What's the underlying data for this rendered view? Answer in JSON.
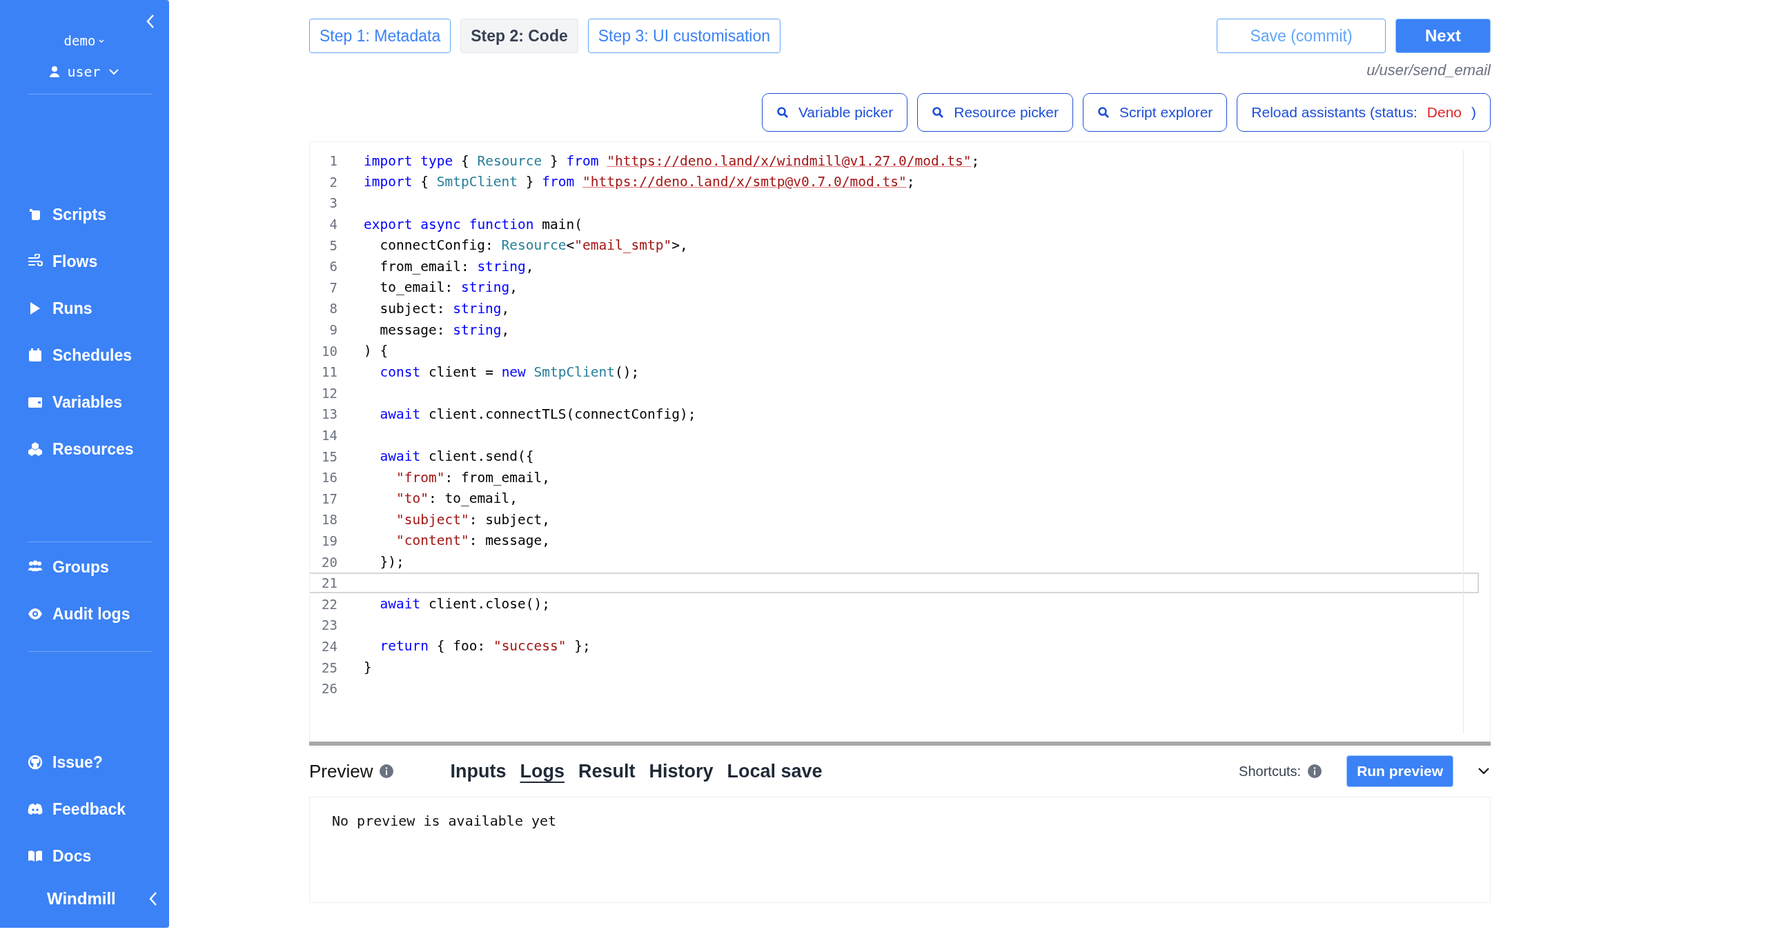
{
  "sidebar": {
    "workspace": "demo",
    "user": "user",
    "nav": [
      {
        "label": "Scripts"
      },
      {
        "label": "Flows"
      },
      {
        "label": "Runs"
      },
      {
        "label": "Schedules"
      },
      {
        "label": "Variables"
      },
      {
        "label": "Resources"
      }
    ],
    "admin": [
      {
        "label": "Groups"
      },
      {
        "label": "Audit logs"
      }
    ],
    "links": [
      {
        "label": "Issue?"
      },
      {
        "label": "Feedback"
      },
      {
        "label": "Docs"
      }
    ],
    "footer": "Windmill"
  },
  "steps": [
    {
      "label": "Step 1: Metadata",
      "selected": false
    },
    {
      "label": "Step 2: Code",
      "selected": true
    },
    {
      "label": "Step 3: UI customisation",
      "selected": false
    }
  ],
  "save_button": "Save (commit)",
  "next_button": "Next",
  "path": "u/user/send_email",
  "tools": [
    {
      "label": "Variable picker",
      "kind": "search"
    },
    {
      "label": "Resource picker",
      "kind": "search"
    },
    {
      "label": "Script explorer",
      "kind": "search"
    },
    {
      "label": "Reload assistants (status: ",
      "status": "Deno",
      "suffix": ")",
      "kind": "status"
    }
  ],
  "code": [
    {
      "n": "1",
      "current": false,
      "text": "import type { Resource } from \"https://deno.land/x/windmill@v1.27.0/mod.ts\";"
    },
    {
      "n": "2",
      "current": false,
      "text": "import { SmtpClient } from \"https://deno.land/x/smtp@v0.7.0/mod.ts\";"
    },
    {
      "n": "3",
      "current": false
    },
    {
      "n": "4",
      "current": false,
      "text": "export async function main("
    },
    {
      "n": "5",
      "current": false,
      "text": "  connectConfig: Resource<\"email_smtp\">,"
    },
    {
      "n": "6",
      "current": false,
      "text": "  from_email: string,"
    },
    {
      "n": "7",
      "current": false,
      "text": "  to_email: string,"
    },
    {
      "n": "8",
      "current": false,
      "text": "  subject: string,"
    },
    {
      "n": "9",
      "current": false,
      "text": "  message: string,"
    },
    {
      "n": "10",
      "current": false,
      "text": ") {"
    },
    {
      "n": "11",
      "current": false,
      "text": "  const client = new SmtpClient();"
    },
    {
      "n": "12",
      "current": false
    },
    {
      "n": "13",
      "current": false,
      "text": "  await client.connectTLS(connectConfig);"
    },
    {
      "n": "14",
      "current": false
    },
    {
      "n": "15",
      "current": false,
      "text": "  await client.send({"
    },
    {
      "n": "16",
      "current": false,
      "text": "    \"from\": from_email,"
    },
    {
      "n": "17",
      "current": false,
      "text": "    \"to\": to_email,"
    },
    {
      "n": "18",
      "current": false,
      "text": "    \"subject\": subject,"
    },
    {
      "n": "19",
      "current": false,
      "text": "    \"content\": message,"
    },
    {
      "n": "20",
      "current": false,
      "text": "  });"
    },
    {
      "n": "21",
      "current": true
    },
    {
      "n": "22",
      "current": false,
      "text": "  await client.close();"
    },
    {
      "n": "23",
      "current": false
    },
    {
      "n": "24",
      "current": false,
      "text": "  return { foo: \"success\" };"
    },
    {
      "n": "25",
      "current": false,
      "text": "}"
    },
    {
      "n": "26",
      "current": false
    }
  ],
  "preview": {
    "title": "Preview",
    "tabs": [
      {
        "label": "Inputs",
        "selected": false
      },
      {
        "label": "Logs",
        "selected": true
      },
      {
        "label": "Result",
        "selected": false
      },
      {
        "label": "History",
        "selected": false
      },
      {
        "label": "Local save",
        "selected": false
      }
    ],
    "shortcuts": "Shortcuts:",
    "run_button": "Run preview",
    "output": "No preview is available yet"
  }
}
